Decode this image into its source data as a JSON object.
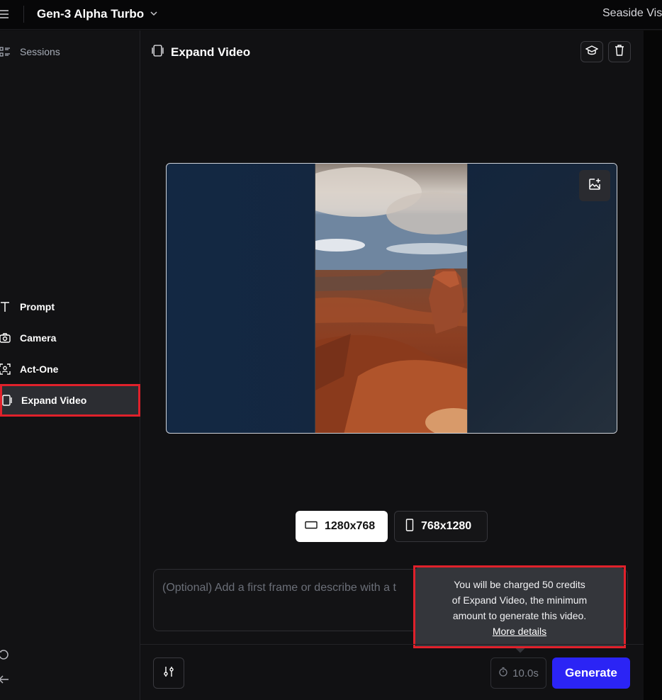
{
  "topbar": {
    "model_name": "Gen-3 Alpha Turbo",
    "project_name": "Seaside Vis"
  },
  "sidebar": {
    "sessions_label": "Sessions",
    "items": [
      {
        "label": "Prompt",
        "icon": "text-icon"
      },
      {
        "label": "Camera",
        "icon": "camera-icon"
      },
      {
        "label": "Act-One",
        "icon": "face-scan-icon"
      },
      {
        "label": "Expand Video",
        "icon": "expand-video-icon",
        "active": true
      }
    ]
  },
  "main": {
    "title": "Expand Video",
    "aspect_options": [
      {
        "label": "1280x768",
        "selected": true
      },
      {
        "label": "768x1280",
        "selected": false
      }
    ],
    "prompt_placeholder": "(Optional) Add a first frame or describe with a t",
    "tooltip": {
      "line1": "You will be charged 50 credits",
      "line2": "of Expand Video, the minimum",
      "line3": "amount to generate this video.",
      "link": "More details"
    },
    "duration": "10.0s",
    "generate_label": "Generate"
  },
  "colors": {
    "accent": "#2b24f5",
    "highlight": "#e0212b",
    "background": "#111113"
  }
}
